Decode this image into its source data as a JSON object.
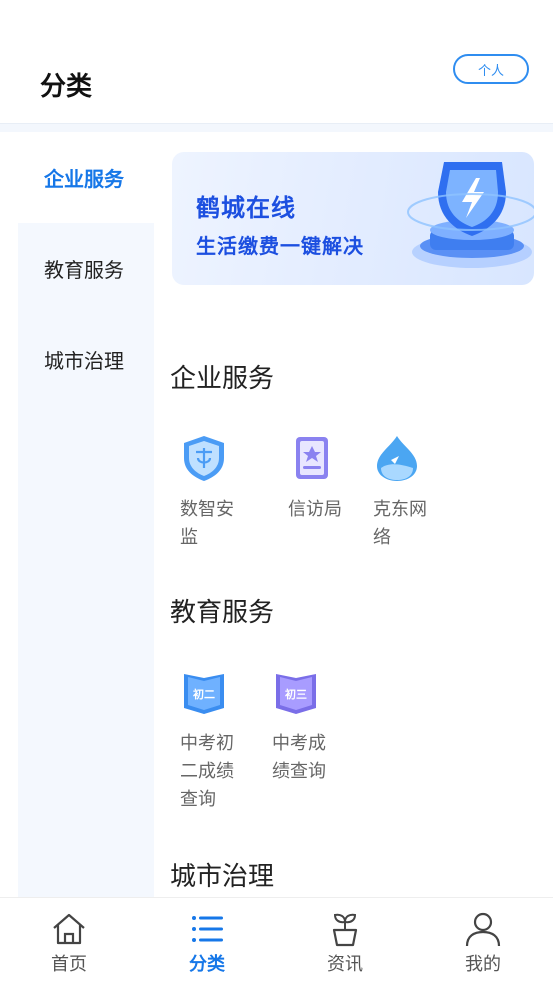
{
  "header": {
    "title": "分类",
    "personal_label": "个人"
  },
  "sidebar": {
    "items": [
      {
        "label": "企业服务",
        "active": true
      },
      {
        "label": "教育服务",
        "active": false
      },
      {
        "label": "城市治理",
        "active": false
      }
    ]
  },
  "banner": {
    "line1": "鹤城在线",
    "line2": "生活缴费一键解决"
  },
  "sections": [
    {
      "title": "企业服务",
      "apps": [
        {
          "label": "数智安监",
          "icon": "shield-icon"
        },
        {
          "label": "信访局",
          "icon": "document-icon"
        },
        {
          "label": "克东网络",
          "icon": "water-drop-icon"
        }
      ]
    },
    {
      "title": "教育服务",
      "apps": [
        {
          "label": "中考初二成绩查询",
          "icon": "book-icon",
          "badge": "初二"
        },
        {
          "label": "中考成绩查询",
          "icon": "book-icon",
          "badge": "初三"
        }
      ]
    },
    {
      "title": "城市治理",
      "apps": []
    }
  ],
  "tabbar": {
    "items": [
      {
        "label": "首页",
        "icon": "home-icon",
        "active": false
      },
      {
        "label": "分类",
        "icon": "list-icon",
        "active": true
      },
      {
        "label": "资讯",
        "icon": "plant-icon",
        "active": false
      },
      {
        "label": "我的",
        "icon": "user-icon",
        "active": false
      }
    ]
  },
  "colors": {
    "accent": "#1677e8",
    "sidebar_bg": "#f4f8fe",
    "banner_text": "#1c4fe0"
  }
}
